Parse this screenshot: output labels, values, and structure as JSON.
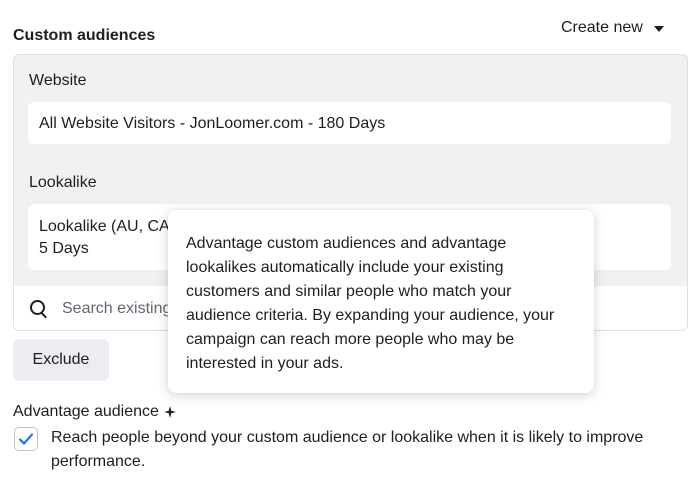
{
  "section": {
    "title": "Custom audiences",
    "create_new": "Create new"
  },
  "audiences": {
    "groups": [
      {
        "label": "Website",
        "value": "All Website Visitors - JonLoomer.com - 180 Days"
      },
      {
        "label": "Lookalike",
        "value_line1": "Lookalike (AU, CA",
        "value_line2": "5 Days"
      }
    ],
    "search_placeholder": "Search existing"
  },
  "exclude_button": "Exclude",
  "advantage": {
    "title": "Advantage audience",
    "checked": true,
    "description": "Reach people beyond your custom audience or lookalike when it is likely to improve performance."
  },
  "tooltip": {
    "text": "Advantage custom audiences and advantage lookalikes automatically include your existing customers and similar people who match your audience criteria. By expanding your audience, your campaign can reach more people who may be interested in your ads."
  },
  "colors": {
    "panel_gray": "#f0f1f2",
    "checkmark_blue": "#1877f2",
    "button_gray": "#ebedf0"
  },
  "icons": [
    "search-icon",
    "sparkle-icon",
    "checkmark-icon",
    "caret-down-icon"
  ]
}
